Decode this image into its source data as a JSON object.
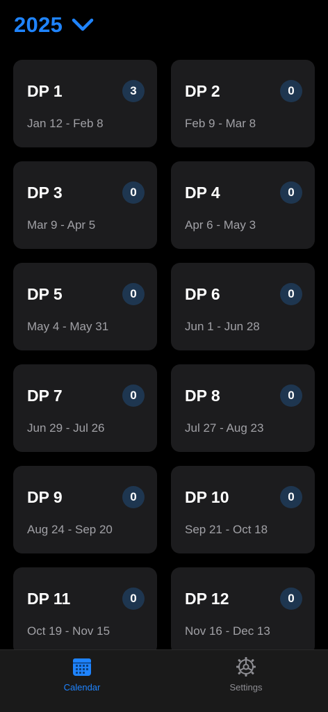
{
  "header": {
    "year": "2025"
  },
  "periods": [
    {
      "title": "DP 1",
      "range": "Jan 12 - Feb 8",
      "count": "3"
    },
    {
      "title": "DP 2",
      "range": "Feb 9 - Mar 8",
      "count": "0"
    },
    {
      "title": "DP 3",
      "range": "Mar 9 - Apr 5",
      "count": "0"
    },
    {
      "title": "DP 4",
      "range": "Apr 6 - May 3",
      "count": "0"
    },
    {
      "title": "DP 5",
      "range": "May 4 - May 31",
      "count": "0"
    },
    {
      "title": "DP 6",
      "range": "Jun 1 - Jun 28",
      "count": "0"
    },
    {
      "title": "DP 7",
      "range": "Jun 29 - Jul 26",
      "count": "0"
    },
    {
      "title": "DP 8",
      "range": "Jul 27 - Aug 23",
      "count": "0"
    },
    {
      "title": "DP 9",
      "range": "Aug 24 - Sep 20",
      "count": "0"
    },
    {
      "title": "DP 10",
      "range": "Sep 21 - Oct 18",
      "count": "0"
    },
    {
      "title": "DP 11",
      "range": "Oct 19 - Nov 15",
      "count": "0"
    },
    {
      "title": "DP 12",
      "range": "Nov 16 - Dec 13",
      "count": "0"
    }
  ],
  "tabbar": {
    "calendar_label": "Calendar",
    "settings_label": "Settings",
    "active": "calendar"
  },
  "icons": {
    "year_toggle": "chevron-down-icon",
    "calendar": "calendar-icon",
    "settings": "gear-icon"
  },
  "colors": {
    "accent": "#1f84ff",
    "card_background": "#1c1c1e",
    "badge_background": "#1e3650",
    "muted_text": "#a1a1a6",
    "inactive_tab": "#8e8e93"
  }
}
